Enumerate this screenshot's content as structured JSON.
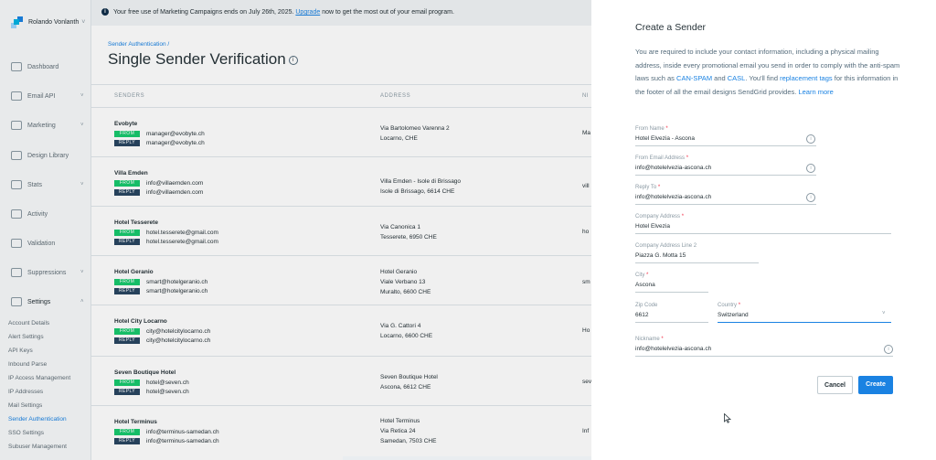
{
  "user": {
    "name": "Rolando Vonlanth",
    "caret": "˅"
  },
  "nav": [
    {
      "label": "Dashboard",
      "icon": "dashboard-icon",
      "chevron": ""
    },
    {
      "label": "Email API",
      "icon": "email-api-icon",
      "chevron": "˅"
    },
    {
      "label": "Marketing",
      "icon": "marketing-icon",
      "chevron": "˅"
    },
    {
      "label": "Design Library",
      "icon": "design-library-icon",
      "chevron": ""
    },
    {
      "label": "Stats",
      "icon": "stats-icon",
      "chevron": "˅"
    },
    {
      "label": "Activity",
      "icon": "activity-icon",
      "chevron": ""
    },
    {
      "label": "Validation",
      "icon": "validation-icon",
      "chevron": ""
    },
    {
      "label": "Suppressions",
      "icon": "suppressions-icon",
      "chevron": "˅"
    },
    {
      "label": "Settings",
      "icon": "settings-icon",
      "chevron": "˄"
    }
  ],
  "settings_sub": [
    "Account Details",
    "Alert Settings",
    "API Keys",
    "Inbound Parse",
    "IP Access Management",
    "IP Addresses",
    "Mail Settings",
    "Sender Authentication",
    "SSO Settings",
    "Subuser Management"
  ],
  "banner": {
    "before": "Your free use of Marketing Campaigns ends on July 26th, 2025.",
    "link": "Upgrade",
    "after": "now to get the most out of your email program.",
    "info_glyph": "i"
  },
  "breadcrumb": "Sender Authentication /",
  "page_title": "Single Sender Verification",
  "title_info_glyph": "i",
  "table": {
    "headers": {
      "senders": "SENDERS",
      "address": "ADDRESS",
      "nickname": "NI"
    },
    "tag_from": "FROM",
    "tag_reply": "REPLY",
    "rows": [
      {
        "name": "Evobyte",
        "from": "manager@evobyte.ch",
        "reply": "manager@evobyte.ch",
        "addr1": "Via Bartolomeo Varenna 2",
        "addr2": "Locarno, CHE",
        "nick": "Ma"
      },
      {
        "name": "Villa Emden",
        "from": "info@villaemden.com",
        "reply": "info@villaemden.com",
        "addr1": "Villa Emden - Isole di Brissago",
        "addr2": "Isole di Brissago, 6614 CHE",
        "nick": "vill"
      },
      {
        "name": "Hotel Tesserete",
        "from": "hotel.tesserete@gmail.com",
        "reply": "hotel.tesserete@gmail.com",
        "addr1": "Via Canonica 1",
        "addr2": "Tesserete, 6950 CHE",
        "nick": "ho"
      },
      {
        "name": "Hotel Geranio",
        "from": "smart@hotelgeranio.ch",
        "reply": "smart@hotelgeranio.ch",
        "addr1": "Hotel Geranio",
        "addr2": "Viale Verbano 13",
        "addr3": "Muralto, 6600 CHE",
        "nick": "sm"
      },
      {
        "name": "Hotel City Locarno",
        "from": "city@hotelcitylocarno.ch",
        "reply": "city@hotelcitylocarno.ch",
        "addr1": "Via G. Cattori 4",
        "addr2": "Locarno, 6600 CHE",
        "nick": "Ho"
      },
      {
        "name": "Seven Boutique Hotel",
        "from": "hotel@seven.ch",
        "reply": "hotel@seven.ch",
        "addr1": "Seven Boutique Hotel",
        "addr2": "Ascona, 6612 CHE",
        "nick": "sev"
      },
      {
        "name": "Hotel Terminus",
        "from": "info@terminus-samedan.ch",
        "reply": "info@terminus-samedan.ch",
        "addr1": "Hotel Terminus",
        "addr2": "Via Retica 24",
        "addr3": "Samedan, 7503 CHE",
        "nick": "Inf"
      }
    ]
  },
  "drawer": {
    "title": "Create a Sender",
    "desc_1": "You are required to include your contact information, including a physical mailing address, inside every promotional email you send in order to comply with the anti-spam laws such as",
    "link_canspam": "CAN-SPAM",
    "desc_and": "and",
    "link_casl": "CASL",
    "desc_2": ". You'll find",
    "link_tags": "replacement tags",
    "desc_3": "for this information in the footer of all the email designs SendGrid provides.",
    "link_learn": "Learn more",
    "required_mark": "*",
    "info_glyph": "i",
    "fields": {
      "from_name": {
        "label": "From Name",
        "value": "Hotel Elvezia - Ascona"
      },
      "from_email": {
        "label": "From Email Address",
        "value": "info@hotelelvezia-ascona.ch"
      },
      "reply_to": {
        "label": "Reply To",
        "value": "info@hotelelvezia-ascona.ch"
      },
      "company_address": {
        "label": "Company Address",
        "value": "Hotel Elvezia"
      },
      "company_address_2": {
        "label": "Company Address Line 2",
        "value": "Piazza G. Motta 15"
      },
      "city": {
        "label": "City",
        "value": "Ascona"
      },
      "zip": {
        "label": "Zip Code",
        "value": "6612"
      },
      "country": {
        "label": "Country",
        "value": "Switzerland",
        "caret": "˅"
      },
      "nickname": {
        "label": "Nickname",
        "value": "info@hotelelvezia-ascona.ch"
      }
    },
    "cancel_label": "Cancel",
    "create_label": "Create"
  },
  "colors": {
    "accent": "#1a82e2",
    "from_tag": "#18c96e",
    "reply_tag": "#294661",
    "required": "#f22f46"
  }
}
